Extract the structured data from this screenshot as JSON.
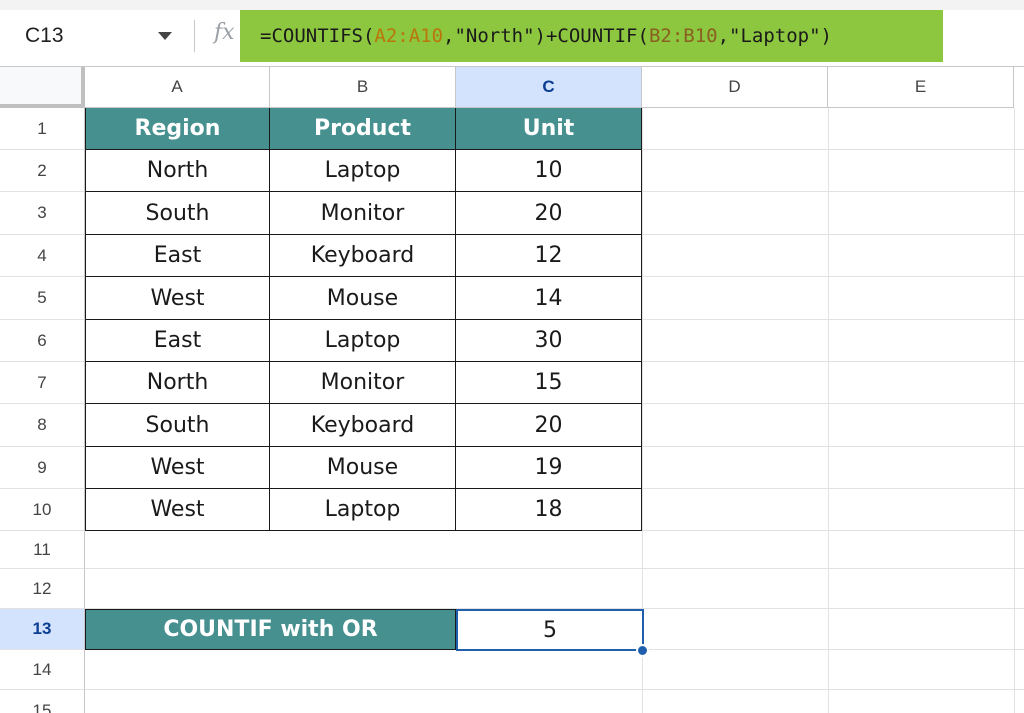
{
  "name_box": {
    "value": "C13"
  },
  "formula_bar": {
    "fx_label": "fx",
    "parts": [
      {
        "text": "=COUNTIFS(",
        "role": "fn"
      },
      {
        "text": "A2:A10",
        "role": "range1"
      },
      {
        "text": ",\"North\")+COUNTIF(",
        "role": "fn"
      },
      {
        "text": "B2:B10",
        "role": "range2"
      },
      {
        "text": ",\"Laptop\")",
        "role": "fn"
      }
    ]
  },
  "columns": [
    "A",
    "B",
    "C",
    "D",
    "E"
  ],
  "selected_column": "C",
  "rows": [
    "1",
    "2",
    "3",
    "4",
    "5",
    "6",
    "7",
    "8",
    "9",
    "10",
    "11",
    "12",
    "13",
    "14",
    "15"
  ],
  "selected_row": "13",
  "table": {
    "headers": [
      "Region",
      "Product",
      "Unit"
    ],
    "rows": [
      [
        "North",
        "Laptop",
        "10"
      ],
      [
        "South",
        "Monitor",
        "20"
      ],
      [
        "East",
        "Keyboard",
        "12"
      ],
      [
        "West",
        "Mouse",
        "14"
      ],
      [
        "East",
        "Laptop",
        "30"
      ],
      [
        "North",
        "Monitor",
        "15"
      ],
      [
        "South",
        "Keyboard",
        "20"
      ],
      [
        "West",
        "Mouse",
        "19"
      ],
      [
        "West",
        "Laptop",
        "18"
      ]
    ]
  },
  "summary": {
    "label": "COUNTIF with OR",
    "value": "5"
  },
  "colors": {
    "header_fill": "#46908f",
    "formula_highlight": "#8dc63f",
    "selection_blue": "#1f5fae"
  }
}
